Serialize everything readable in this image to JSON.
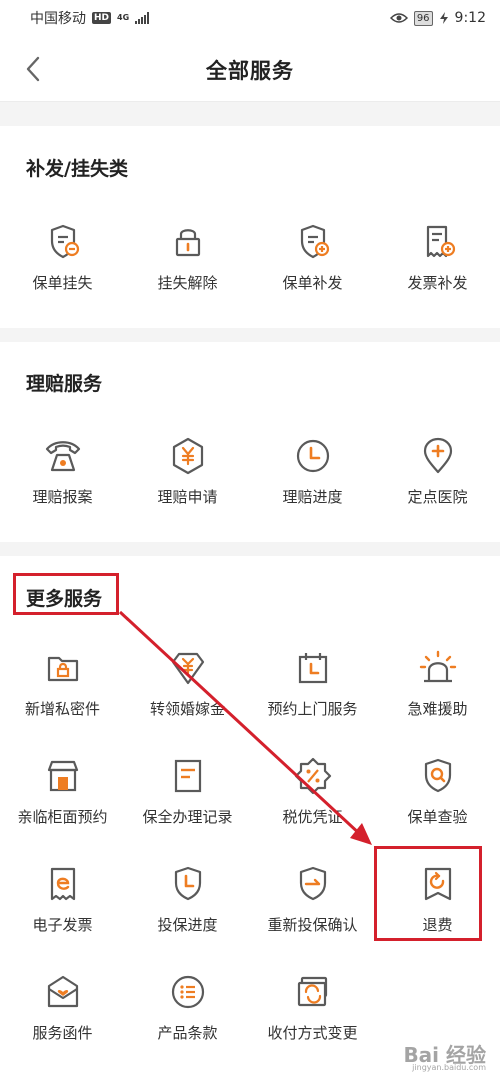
{
  "status_bar": {
    "carrier": "中国移动",
    "hd_badge": "HD",
    "network": "4G",
    "battery": "96",
    "time": "9:12"
  },
  "header": {
    "title": "全部服务"
  },
  "sections": [
    {
      "title": "补发/挂失类",
      "items": [
        {
          "label": "保单挂失",
          "icon": "policy-shield-minus-icon"
        },
        {
          "label": "挂失解除",
          "icon": "padlock-icon"
        },
        {
          "label": "保单补发",
          "icon": "policy-shield-plus-icon"
        },
        {
          "label": "发票补发",
          "icon": "invoice-plus-icon"
        }
      ]
    },
    {
      "title": "理赔服务",
      "items": [
        {
          "label": "理赔报案",
          "icon": "telephone-icon"
        },
        {
          "label": "理赔申请",
          "icon": "yuan-hexagon-icon"
        },
        {
          "label": "理赔进度",
          "icon": "clock-icon"
        },
        {
          "label": "定点医院",
          "icon": "location-pin-plus-icon"
        }
      ]
    },
    {
      "title": "更多服务",
      "items": [
        {
          "label": "新增私密件",
          "icon": "private-folder-icon"
        },
        {
          "label": "转领婚嫁金",
          "icon": "wedding-yuan-icon"
        },
        {
          "label": "预约上门服务",
          "icon": "calendar-clock-icon"
        },
        {
          "label": "急难援助",
          "icon": "alarm-light-icon"
        },
        {
          "label": "亲临柜面预约",
          "icon": "store-icon"
        },
        {
          "label": "保全办理记录",
          "icon": "document-record-icon"
        },
        {
          "label": "税优凭证",
          "icon": "tax-percent-badge-icon"
        },
        {
          "label": "保单查验",
          "icon": "shield-search-icon"
        },
        {
          "label": "电子发票",
          "icon": "e-invoice-icon"
        },
        {
          "label": "投保进度",
          "icon": "shield-clock-icon"
        },
        {
          "label": "重新投保确认",
          "icon": "shield-arrow-icon"
        },
        {
          "label": "退费",
          "icon": "refund-icon"
        },
        {
          "label": "服务函件",
          "icon": "letter-heart-icon"
        },
        {
          "label": "产品条款",
          "icon": "list-icon"
        },
        {
          "label": "收付方式变更",
          "icon": "payment-change-icon"
        }
      ]
    }
  ],
  "watermark": {
    "text": "Bai 经验",
    "sub": "jingyan.baidu.com"
  },
  "colors": {
    "accent": "#ee7d22",
    "icon_stroke": "#5a5a5a",
    "annotation": "#d4202c"
  }
}
